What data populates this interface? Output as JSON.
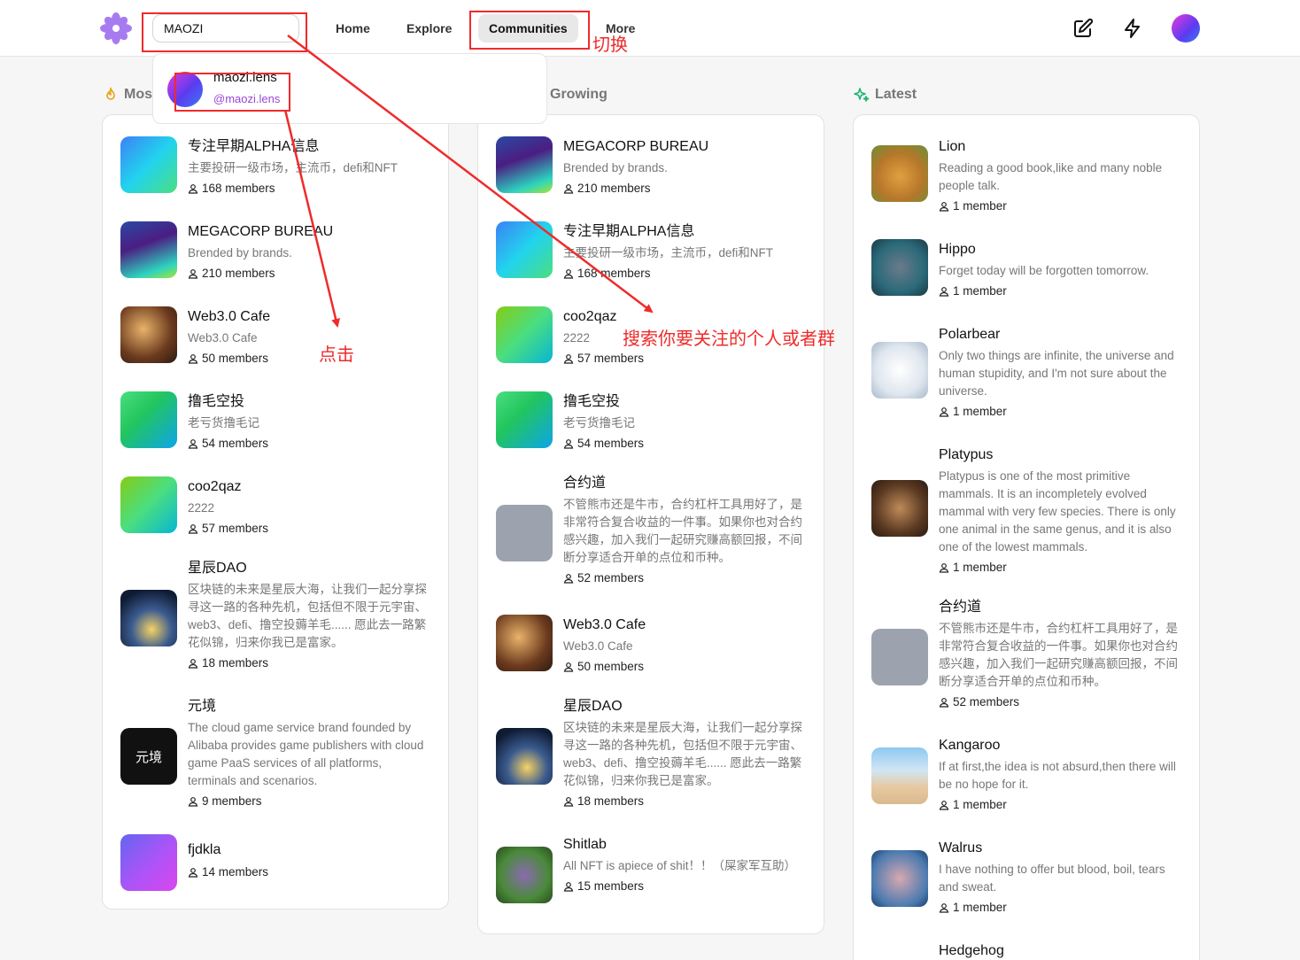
{
  "header": {
    "search_value": "MAOZI",
    "nav": [
      "Home",
      "Explore",
      "Communities",
      "More"
    ],
    "active_nav": "Communities"
  },
  "dropdown": {
    "name": "maozi.lens",
    "handle": "@maozi.lens"
  },
  "annotations": {
    "switch": "切换",
    "click": "点击",
    "search_hint": "搜索你要关注的个人或者群"
  },
  "columns": {
    "most_active": {
      "title": "Most Active",
      "title_visible": "Mos",
      "items": [
        {
          "name": "专注早期ALPHA信息",
          "desc": "主要投研一级市场，主流币，defi和NFT",
          "members": "168 members"
        },
        {
          "name": "MEGACORP BUREAU",
          "desc": "Brended by brands.",
          "members": "210 members"
        },
        {
          "name": "Web3.0 Cafe",
          "desc": "Web3.0 Cafe",
          "members": "50 members"
        },
        {
          "name": "撸毛空投",
          "desc": "老亏货撸毛记",
          "members": "54 members"
        },
        {
          "name": "coo2qaz",
          "desc": "2222",
          "members": "57 members"
        },
        {
          "name": "星辰DAO",
          "desc": "区块链的未来是星辰大海，让我们一起分享探寻这一路的各种先机，包括但不限于元宇宙、web3、defi、撸空投薅羊毛...... 愿此去一路繁花似锦，归来你我已是富家。",
          "members": "18 members"
        },
        {
          "name": "元境",
          "desc": "The cloud game service brand founded by Alibaba provides game publishers with cloud game PaaS services of all platforms, terminals and scenarios.",
          "members": "9 members"
        },
        {
          "name": "fjdkla",
          "desc": "",
          "members": "14 members"
        }
      ]
    },
    "growing": {
      "title": "Growing",
      "items": [
        {
          "name": "MEGACORP BUREAU",
          "desc": "Brended by brands.",
          "members": "210 members"
        },
        {
          "name": "专注早期ALPHA信息",
          "desc": "主要投研一级市场，主流币，defi和NFT",
          "members": "168 members"
        },
        {
          "name": "coo2qaz",
          "desc": "2222",
          "members": "57 members"
        },
        {
          "name": "撸毛空投",
          "desc": "老亏货撸毛记",
          "members": "54 members"
        },
        {
          "name": "合约道",
          "desc": "不管熊市还是牛市，合约杠杆工具用好了，是非常符合复合收益的一件事。如果你也对合约感兴趣，加入我们一起研究赚高额回报，不间断分享适合开单的点位和币种。",
          "members": "52 members"
        },
        {
          "name": "Web3.0 Cafe",
          "desc": "Web3.0 Cafe",
          "members": "50 members"
        },
        {
          "name": "星辰DAO",
          "desc": "区块链的未来是星辰大海，让我们一起分享探寻这一路的各种先机，包括但不限于元宇宙、web3、defi、撸空投薅羊毛...... 愿此去一路繁花似锦，归来你我已是富家。",
          "members": "18 members"
        },
        {
          "name": "Shitlab",
          "desc": "All NFT is apiece of shit！！（屎家军互助）",
          "members": "15 members"
        }
      ]
    },
    "latest": {
      "title": "Latest",
      "items": [
        {
          "name": "Lion",
          "desc": "Reading a good book,like and many noble people talk.",
          "members": "1 member"
        },
        {
          "name": "Hippo",
          "desc": "Forget today will be forgotten tomorrow.",
          "members": "1 member"
        },
        {
          "name": "Polarbear",
          "desc": "Only two things are infinite, the universe and human stupidity, and I'm not sure about the universe.",
          "members": "1 member"
        },
        {
          "name": "Platypus",
          "desc": "Platypus is one of the most primitive mammals. It is an incompletely evolved mammal with very few species. There is only one animal in the same genus, and it is also one of the lowest mammals.",
          "members": "1 member"
        },
        {
          "name": "合约道",
          "desc": "不管熊市还是牛市，合约杠杆工具用好了，是非常符合复合收益的一件事。如果你也对合约感兴趣，加入我们一起研究赚高额回报，不间断分享适合开单的点位和币种。",
          "members": "52 members"
        },
        {
          "name": "Kangaroo",
          "desc": "If at first,the idea is not absurd,then there will be no hope for it.",
          "members": "1 member"
        },
        {
          "name": "Walrus",
          "desc": "I have nothing to offer but blood, boil, tears and sweat.",
          "members": "1 member"
        },
        {
          "name": "Hedgehog",
          "desc": "",
          "members": ""
        }
      ]
    }
  },
  "yuanjing_logo_text": "元境"
}
